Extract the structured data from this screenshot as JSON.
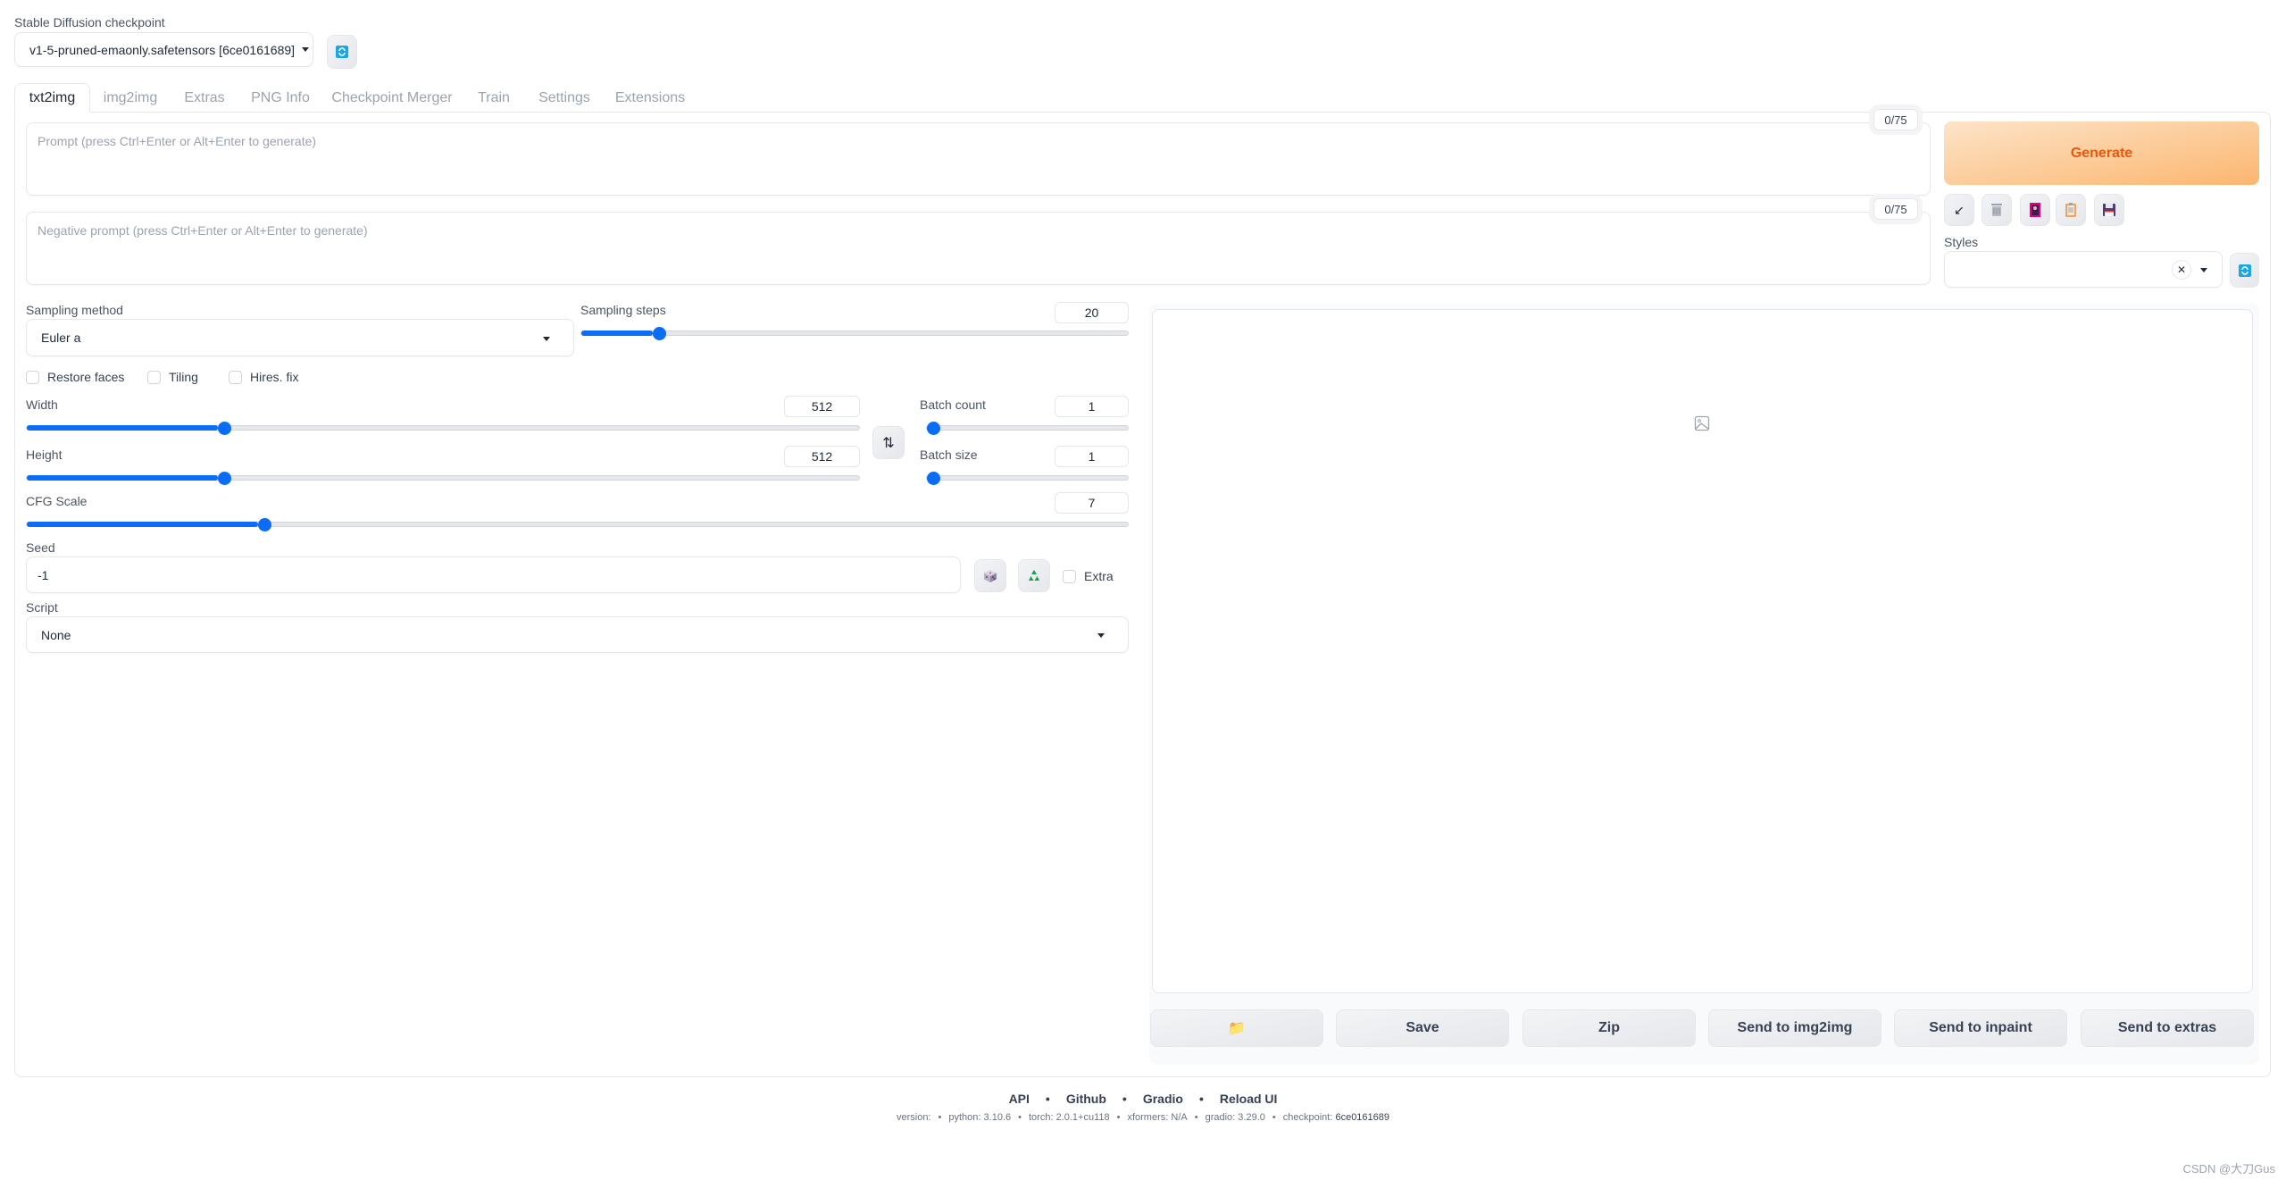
{
  "checkpoint": {
    "label": "Stable Diffusion checkpoint",
    "value": "v1-5-pruned-emaonly.safetensors [6ce0161689]",
    "refresh_icon": "refresh-icon"
  },
  "tabs": [
    {
      "label": "txt2img",
      "active": true
    },
    {
      "label": "img2img",
      "active": false
    },
    {
      "label": "Extras",
      "active": false
    },
    {
      "label": "PNG Info",
      "active": false
    },
    {
      "label": "Checkpoint Merger",
      "active": false
    },
    {
      "label": "Train",
      "active": false
    },
    {
      "label": "Settings",
      "active": false
    },
    {
      "label": "Extensions",
      "active": false
    }
  ],
  "prompt": {
    "placeholder": "Prompt (press Ctrl+Enter or Alt+Enter to generate)",
    "value": "",
    "token_counter": "0/75"
  },
  "negative_prompt": {
    "placeholder": "Negative prompt (press Ctrl+Enter or Alt+Enter to generate)",
    "value": "",
    "token_counter": "0/75"
  },
  "generate": {
    "label": "Generate",
    "tool_icons": [
      "arrow-down-left-icon",
      "trash-icon",
      "picture-card-icon",
      "clipboard-icon",
      "floppy-disk-icon"
    ]
  },
  "styles": {
    "label": "Styles",
    "value": "",
    "clear_icon": "✕"
  },
  "sampling": {
    "method_label": "Sampling method",
    "method_value": "Euler a",
    "steps_label": "Sampling steps",
    "steps_value": "20",
    "steps_fraction": 0.13
  },
  "checkboxes": [
    {
      "label": "Restore faces",
      "checked": false
    },
    {
      "label": "Tiling",
      "checked": false
    },
    {
      "label": "Hires. fix",
      "checked": false
    }
  ],
  "width": {
    "label": "Width",
    "value": "512",
    "fraction": 0.23
  },
  "height": {
    "label": "Height",
    "value": "512",
    "fraction": 0.23
  },
  "batch_count": {
    "label": "Batch count",
    "value": "1",
    "fraction": 0.0
  },
  "batch_size": {
    "label": "Batch size",
    "value": "1",
    "fraction": 0.0
  },
  "swap_icon": "⇅",
  "cfg": {
    "label": "CFG Scale",
    "value": "7",
    "fraction": 0.21
  },
  "seed": {
    "label": "Seed",
    "value": "-1",
    "extra_label": "Extra"
  },
  "script": {
    "label": "Script",
    "value": "None"
  },
  "gallery": {
    "empty_icon": "image-placeholder-icon",
    "buttons": [
      "📁",
      "Save",
      "Zip",
      "Send to img2img",
      "Send to inpaint",
      "Send to extras"
    ]
  },
  "footer": {
    "links": [
      "API",
      "Github",
      "Gradio",
      "Reload UI"
    ],
    "version_items": [
      {
        "k": "version:",
        "v": ""
      },
      {
        "k": "python:",
        "v": "3.10.6"
      },
      {
        "k": "torch:",
        "v": "2.0.1+cu118"
      },
      {
        "k": "xformers:",
        "v": "N/A"
      },
      {
        "k": "gradio:",
        "v": "3.29.0"
      },
      {
        "k": "checkpoint:",
        "v": "6ce0161689"
      }
    ]
  },
  "watermark": "CSDN @大刀Gus",
  "colors": {
    "accent": "#0b6cf5",
    "generate_text": "#ea580c",
    "generate_bg_from": "#fde4c8",
    "generate_bg_to": "#fbb66f"
  }
}
